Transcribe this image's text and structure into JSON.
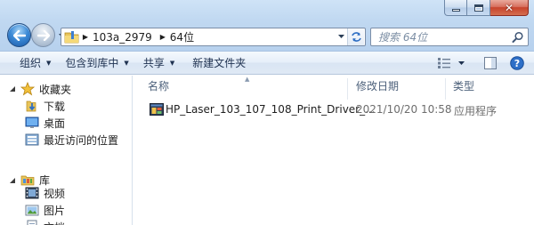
{
  "window": {
    "caption_buttons": [
      "minimize",
      "maximize",
      "close"
    ]
  },
  "address_bar": {
    "breadcrumbs": [
      "103a_2979",
      "64位"
    ]
  },
  "search": {
    "placeholder": "搜索 64位"
  },
  "command_bar": {
    "organize": "组织",
    "include_in_library": "包含到库中",
    "share": "共享",
    "new_folder": "新建文件夹"
  },
  "navigation_pane": {
    "favorites": {
      "label": "收藏夹",
      "items": [
        {
          "label": "下载",
          "icon": "download-folder-icon"
        },
        {
          "label": "桌面",
          "icon": "desktop-icon"
        },
        {
          "label": "最近访问的位置",
          "icon": "recent-places-icon"
        }
      ]
    },
    "libraries": {
      "label": "库",
      "items": [
        {
          "label": "视频",
          "icon": "videos-icon"
        },
        {
          "label": "图片",
          "icon": "pictures-icon"
        },
        {
          "label": "文档",
          "icon": "documents-icon"
        }
      ]
    }
  },
  "file_list": {
    "columns": [
      "名称",
      "修改日期",
      "类型"
    ],
    "rows": [
      {
        "name": "HP_Laser_103_107_108_Print_Driver_...",
        "date": "2021/10/20 10:58",
        "type": "应用程序"
      }
    ]
  },
  "colors": {
    "chrome": "#c0d8f1",
    "command_bar": "#e5eef9",
    "close_button": "#c7432c",
    "back_button": "#3c8ad6"
  }
}
